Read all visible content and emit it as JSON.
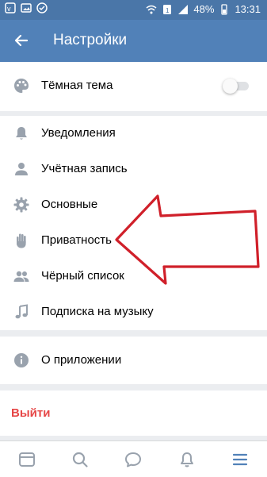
{
  "status_bar": {
    "battery": "48%",
    "time": "13:31"
  },
  "header": {
    "title": "Настройки",
    "back_icon": "arrow-left-icon"
  },
  "theme_section": {
    "dark_theme_label": "Тёмная тема",
    "dark_theme_enabled": false
  },
  "settings_section": {
    "items": [
      {
        "label": "Уведомления",
        "icon": "bell-icon"
      },
      {
        "label": "Учётная запись",
        "icon": "person-icon"
      },
      {
        "label": "Основные",
        "icon": "gear-icon"
      },
      {
        "label": "Приватность",
        "icon": "hand-icon"
      },
      {
        "label": "Чёрный список",
        "icon": "people-icon"
      },
      {
        "label": "Подписка на музыку",
        "icon": "music-note-icon"
      }
    ]
  },
  "about_section": {
    "label": "О приложении",
    "icon": "info-icon"
  },
  "logout": {
    "label": "Выйти"
  },
  "bottom_nav": {
    "items": [
      {
        "icon": "news-icon"
      },
      {
        "icon": "search-icon"
      },
      {
        "icon": "messages-icon"
      },
      {
        "icon": "notifications-icon"
      },
      {
        "icon": "menu-icon",
        "active": true
      }
    ]
  },
  "colors": {
    "accent": "#5181b8",
    "status_bar": "#4a76a8",
    "icon_gray": "#99a2ad",
    "logout_red": "#e64646",
    "arrow_red": "#d0202a"
  }
}
